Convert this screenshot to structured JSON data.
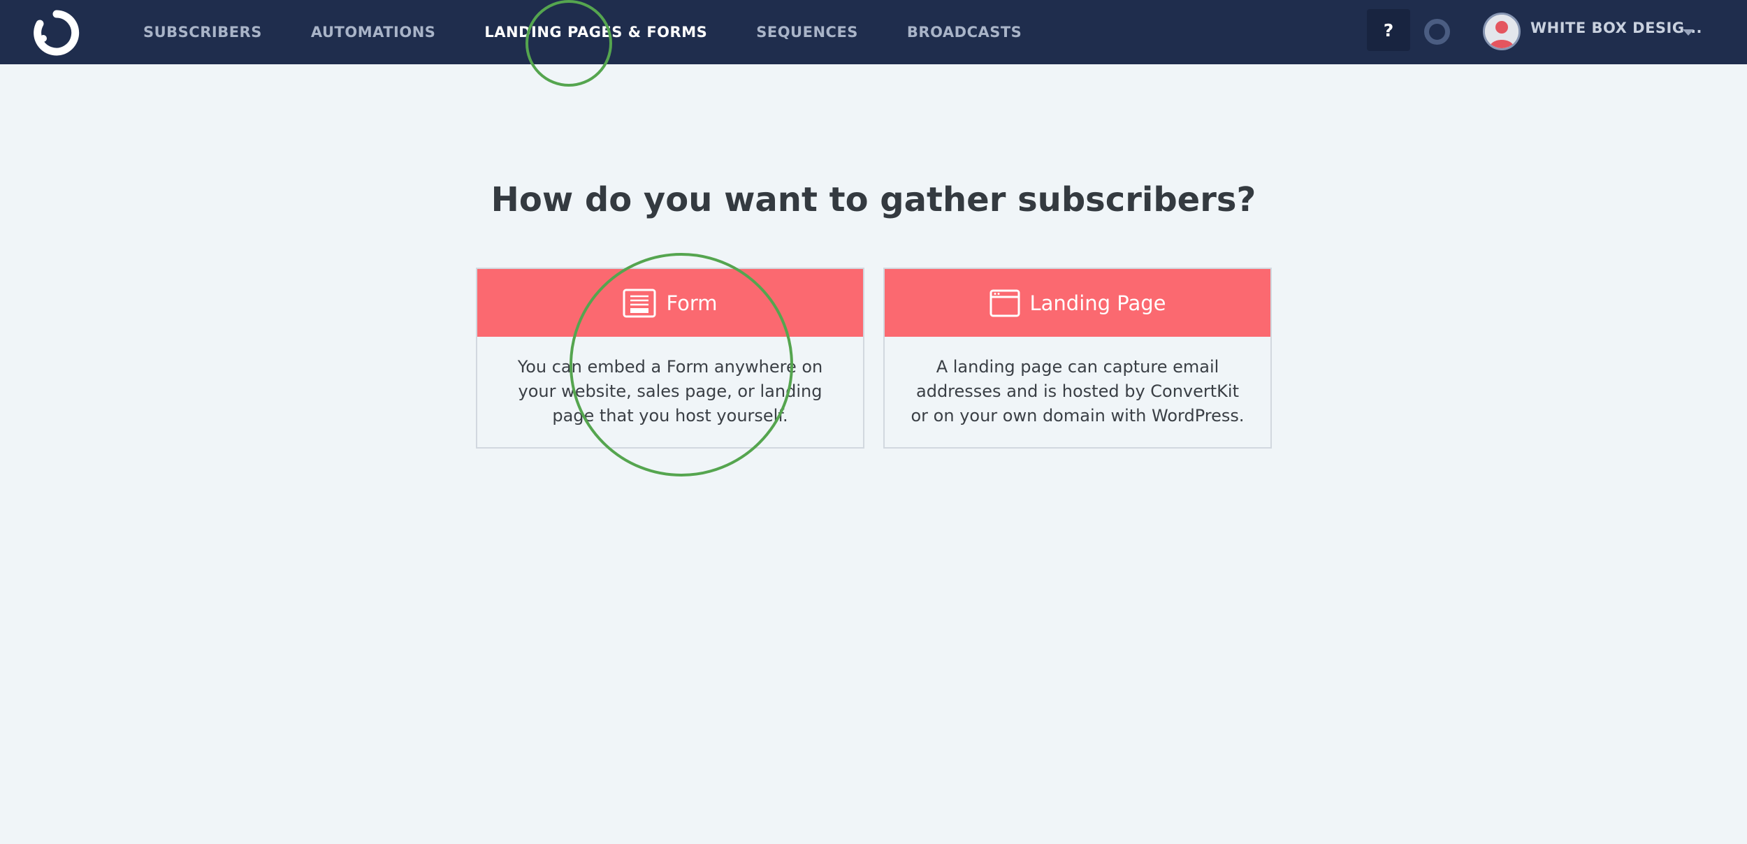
{
  "nav": {
    "items": [
      {
        "label": "SUBSCRIBERS",
        "active": false
      },
      {
        "label": "AUTOMATIONS",
        "active": false
      },
      {
        "label": "LANDING PAGES & FORMS",
        "active": true
      },
      {
        "label": "SEQUENCES",
        "active": false
      },
      {
        "label": "BROADCASTS",
        "active": false
      }
    ],
    "help_label": "?",
    "account_name": "WHITE BOX DESIG..."
  },
  "main": {
    "title": "How do you want to gather subscribers?",
    "cards": [
      {
        "title": "Form",
        "icon": "form-icon",
        "description": "You can embed a Form anywhere on your website, sales page, or landing page that you host yourself."
      },
      {
        "title": "Landing Page",
        "icon": "landing-page-icon",
        "description": "A landing page can capture email addresses and is hosted by ConvertKit or on your own domain with WordPress."
      }
    ]
  },
  "colors": {
    "topbar": "#1f2d4d",
    "accent": "#fb6970",
    "background": "#f0f5f8",
    "annotation": "#55a54f"
  }
}
